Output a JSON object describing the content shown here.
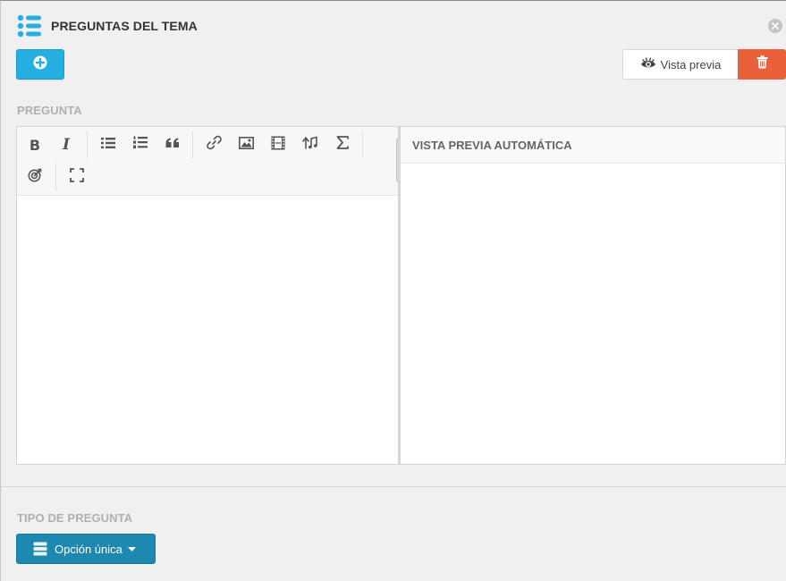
{
  "header": {
    "title": "PREGUNTAS DEL TEMA",
    "icon": "list-icon",
    "accent_color": "#25aee0"
  },
  "actions": {
    "add_icon": "plus-circle-icon",
    "preview_label": "Vista previa",
    "preview_icon": "eye-icon",
    "delete_icon": "trash-icon",
    "delete_color": "#e8613b",
    "close_icon": "close-icon"
  },
  "question": {
    "section_label": "PREGUNTA",
    "toolbar": [
      {
        "name": "bold",
        "icon": "bold-icon",
        "glyph": "B"
      },
      {
        "name": "italic",
        "icon": "italic-icon",
        "glyph": "I"
      },
      {
        "name": "unordered-list",
        "icon": "bullet-list-icon"
      },
      {
        "name": "ordered-list",
        "icon": "numbered-list-icon"
      },
      {
        "name": "quote",
        "icon": "quote-icon"
      },
      {
        "name": "link",
        "icon": "link-icon"
      },
      {
        "name": "image",
        "icon": "image-icon"
      },
      {
        "name": "video",
        "icon": "film-icon"
      },
      {
        "name": "audio",
        "icon": "music-icon"
      },
      {
        "name": "formula",
        "icon": "sigma-icon"
      },
      {
        "name": "target",
        "icon": "target-icon"
      },
      {
        "name": "fullscreen",
        "icon": "fullscreen-icon"
      }
    ],
    "content": "",
    "preview_header": "VISTA PREVIA AUTOMÁTICA"
  },
  "question_type": {
    "section_label": "TIPO DE PREGUNTA",
    "selected": "Opción única",
    "icon": "stack-icon",
    "button_color": "#1d89b0"
  }
}
